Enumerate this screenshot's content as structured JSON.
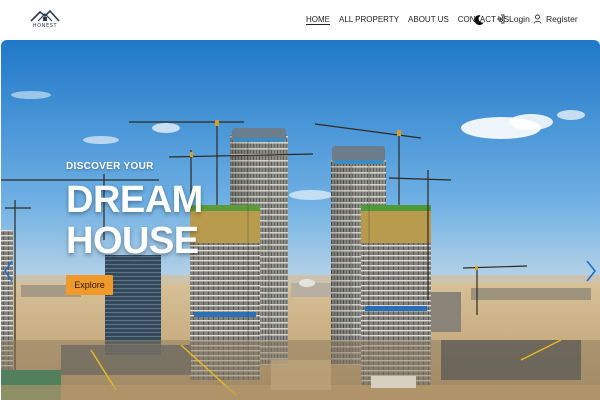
{
  "brand": {
    "logo_text": "HONEST",
    "accent": "#ef9a2a"
  },
  "nav": {
    "links": [
      {
        "label": "HOME",
        "active": true
      },
      {
        "label": "ALL PROPERTY",
        "active": false
      },
      {
        "label": "ABOUT US",
        "active": false
      },
      {
        "label": "CONTACT US",
        "active": false
      }
    ],
    "theme_toggle_icon": "moon-icon",
    "login_label": "Login",
    "login_icon": "sign-in-icon",
    "register_label": "Register",
    "register_icon": "user-icon"
  },
  "hero": {
    "kicker": "DISCOVER YOUR",
    "title_line1": "DREAM",
    "title_line2": "HOUSE",
    "cta_label": "Explore",
    "prev_icon": "chevron-left-icon",
    "next_icon": "chevron-right-icon",
    "background": "construction-site-towers-with-cranes"
  }
}
